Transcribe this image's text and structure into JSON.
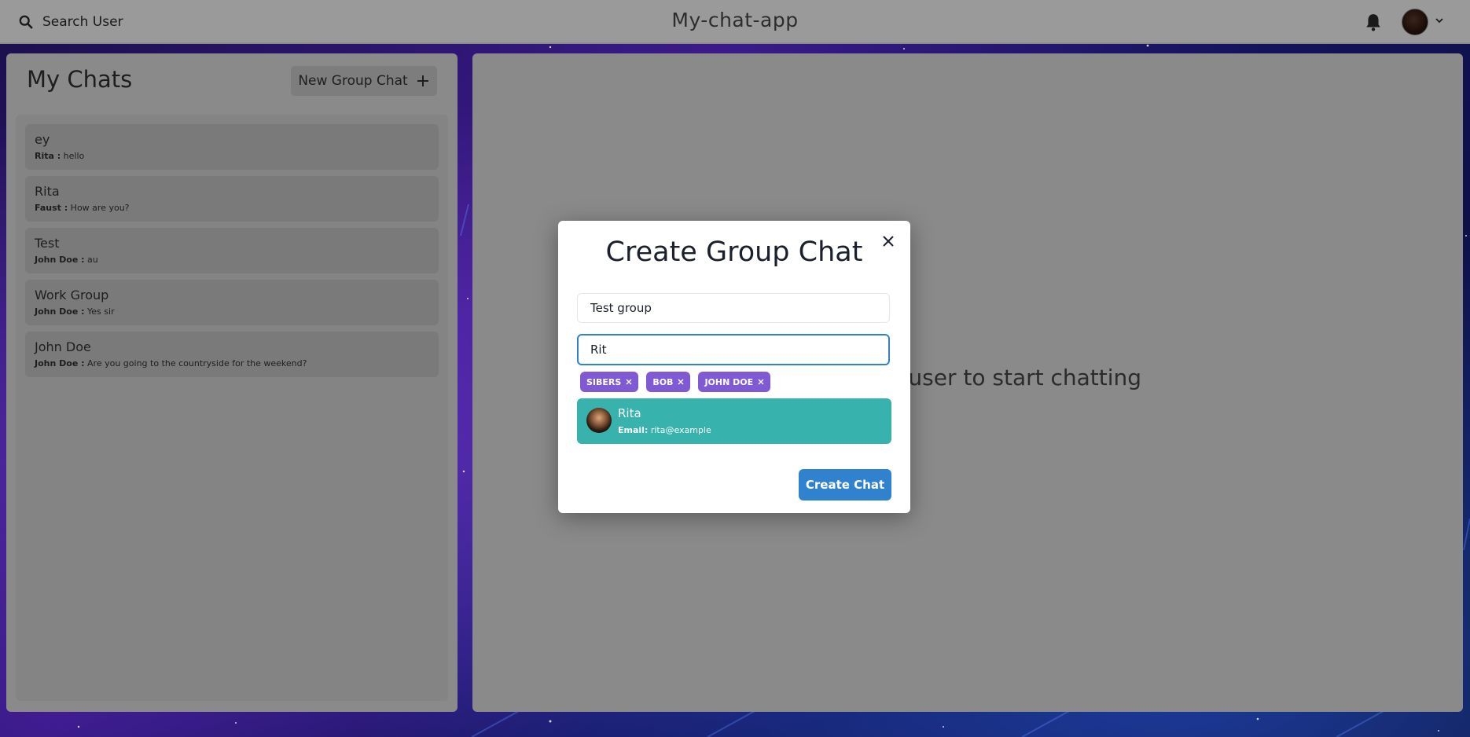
{
  "topbar": {
    "search_label": "Search User",
    "app_title": "My-chat-app"
  },
  "left_panel": {
    "title": "My Chats",
    "new_group_label": "New Group Chat",
    "chats": [
      {
        "name": "ey",
        "sender": "Rita :",
        "message": "hello"
      },
      {
        "name": "Rita",
        "sender": "Faust :",
        "message": "How are you?"
      },
      {
        "name": "Test",
        "sender": "John Doe :",
        "message": "au"
      },
      {
        "name": "Work Group",
        "sender": "John Doe :",
        "message": "Yes sir"
      },
      {
        "name": "John Doe",
        "sender": "John Doe :",
        "message": "Are you going to the countryside for the weekend?"
      }
    ]
  },
  "right_panel": {
    "empty_text": "Click on a user to start chatting"
  },
  "modal": {
    "title": "Create Group Chat",
    "chat_name_value": "Test group",
    "users_search_value": "Rit",
    "selected_users": [
      "SIBERS",
      "BOB",
      "JOHN DOE"
    ],
    "results": [
      {
        "name": "Rita",
        "email_label": "Email:",
        "email": "rita@example"
      }
    ],
    "create_label": "Create Chat"
  },
  "colors": {
    "accent_blue": "#3182ce",
    "chip_purple": "#805ad5",
    "result_teal": "#38b2ac"
  }
}
